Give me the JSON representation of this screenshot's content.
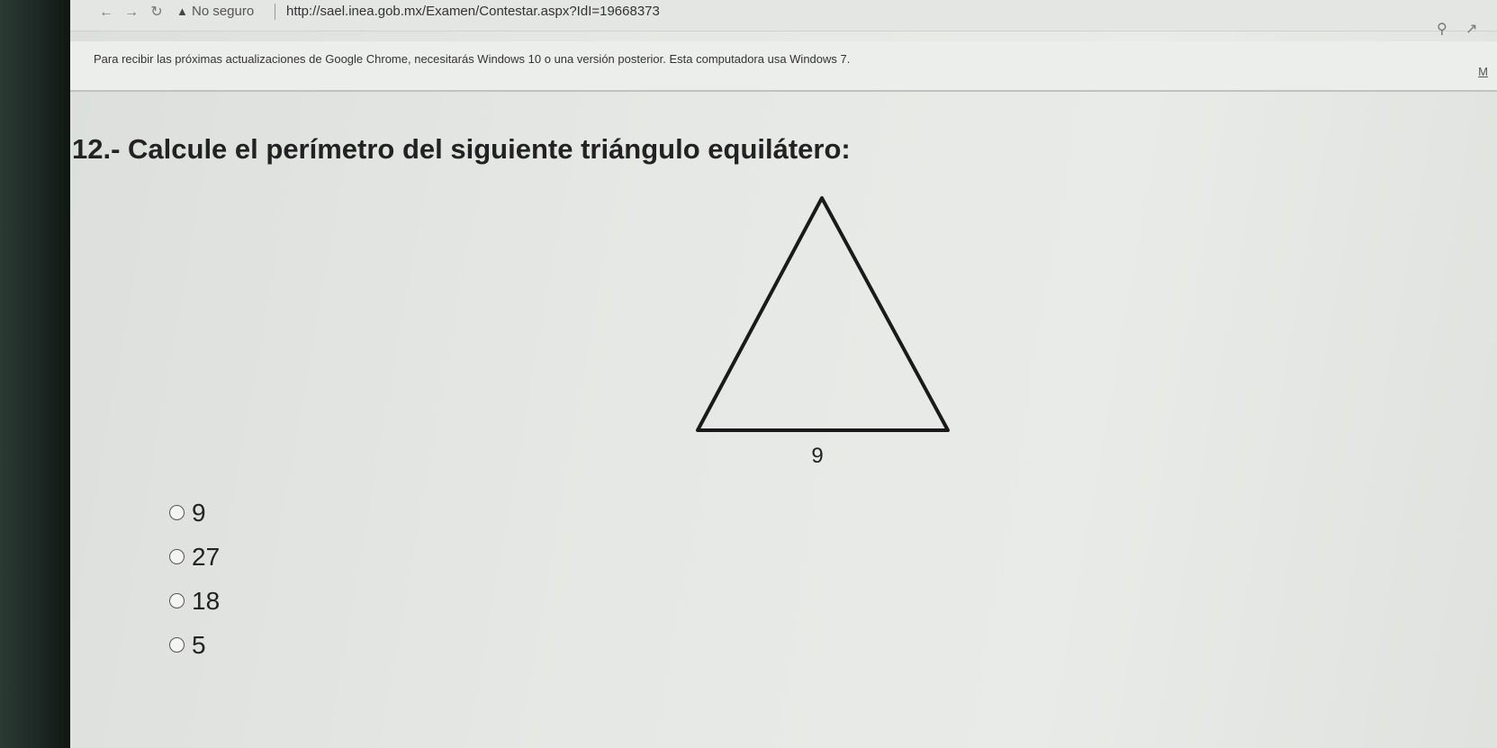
{
  "browser": {
    "security_label": "No seguro",
    "url": "http://sael.inea.gob.mx/Examen/Contestar.aspx?IdI=19668373"
  },
  "infobar": {
    "message": "Para recibir las próximas actualizaciones de Google Chrome, necesitarás Windows 10 o una versión posterior. Esta computadora usa Windows 7.",
    "link": "M"
  },
  "question": {
    "text": "12.- Calcule el perímetro del siguiente triángulo equilátero:",
    "figure_label": "9"
  },
  "options": [
    {
      "label": "9"
    },
    {
      "label": "27"
    },
    {
      "label": "18"
    },
    {
      "label": "5"
    }
  ]
}
